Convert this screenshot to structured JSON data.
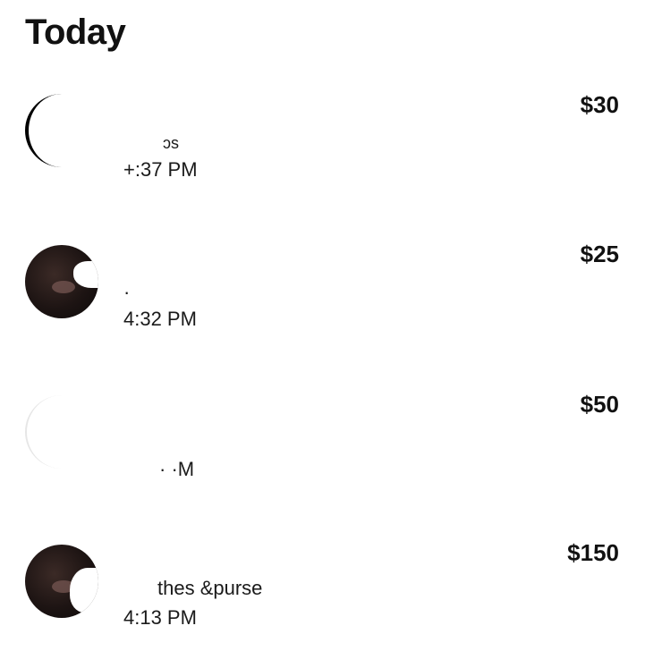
{
  "section": {
    "title": "Today"
  },
  "transactions": [
    {
      "description": "ɔs",
      "time": "+:37 PM",
      "amount": "$30",
      "avatar": "blank"
    },
    {
      "description": "·",
      "time": "4:32 PM",
      "amount": "$25",
      "avatar": "photo"
    },
    {
      "description": "",
      "time": "· ·M",
      "amount": "$50",
      "avatar": "blank"
    },
    {
      "description": "thes &purse",
      "time": "4:13 PM",
      "amount": "$150",
      "avatar": "photo"
    }
  ]
}
